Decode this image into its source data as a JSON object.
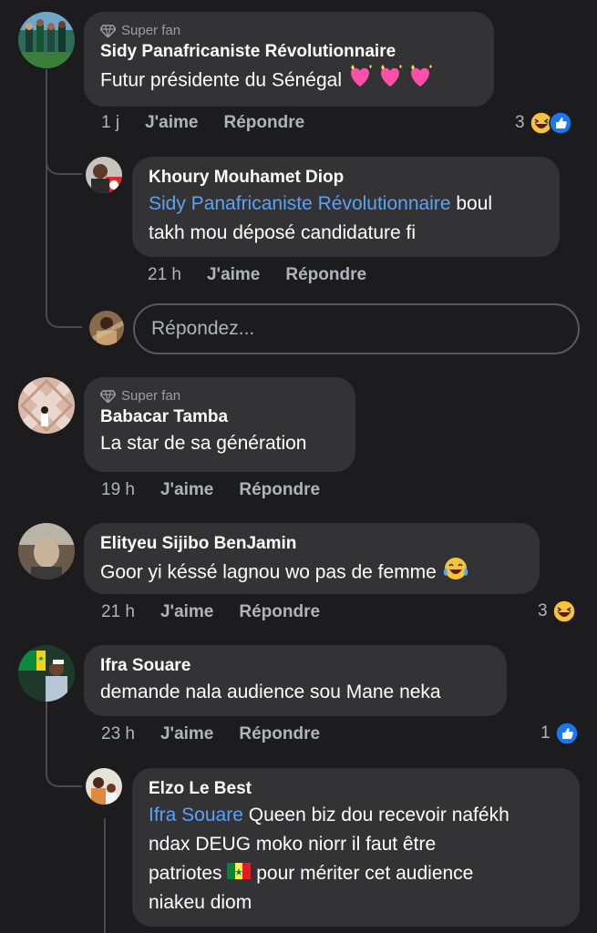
{
  "comments": [
    {
      "badge": "Super fan",
      "author": "Sidy Panafricaniste Révolutionnaire",
      "text": "Futur présidente du Sénégal",
      "time": "1 j",
      "like": "J'aime",
      "reply": "Répondre",
      "reaction_count": "3",
      "reactions": [
        "haha-icon",
        "like-icon"
      ]
    },
    {
      "author": "Khoury Mouhamet Diop",
      "mention": "Sidy Panafricaniste Révolutionnaire",
      "text_line1": " boul",
      "text_line2": "takh mou déposé candidature fi",
      "time": "21 h",
      "like": "J'aime",
      "reply": "Répondre"
    },
    {
      "badge": "Super fan",
      "author": "Babacar Tamba",
      "text": "La star de sa génération",
      "time": "19 h",
      "like": "J'aime",
      "reply": "Répondre"
    },
    {
      "author": "Elityeu Sijibo BenJamin",
      "text": "Goor yi késsé lagnou wo pas de femme",
      "time": "21 h",
      "like": "J'aime",
      "reply": "Répondre",
      "reaction_count": "3",
      "reactions": [
        "haha-icon"
      ]
    },
    {
      "author": "Ifra Souare",
      "text": "demande nala audience sou Mane neka",
      "time": "23 h",
      "like": "J'aime",
      "reply": "Répondre",
      "reaction_count": "1",
      "reactions": [
        "like-icon"
      ]
    },
    {
      "author": "Elzo Le Best",
      "mention": "Ifra Souare",
      "line1_rest": " Queen biz dou recevoir nafékh",
      "line2": "ndax DEUG moko niorr il faut être",
      "line3_a": "patriotes ",
      "line3_b": " pour mériter cet audience",
      "line4": "niakeu diom"
    }
  ],
  "reply_input": {
    "placeholder": "Répondez..."
  },
  "colors": {
    "background": "#1c1c1e",
    "bubble": "#333336",
    "mention": "#5aa2f6",
    "meta": "#b0b3b8",
    "like_blue": "#1877f2",
    "haha_yellow": "#f7c33c"
  }
}
